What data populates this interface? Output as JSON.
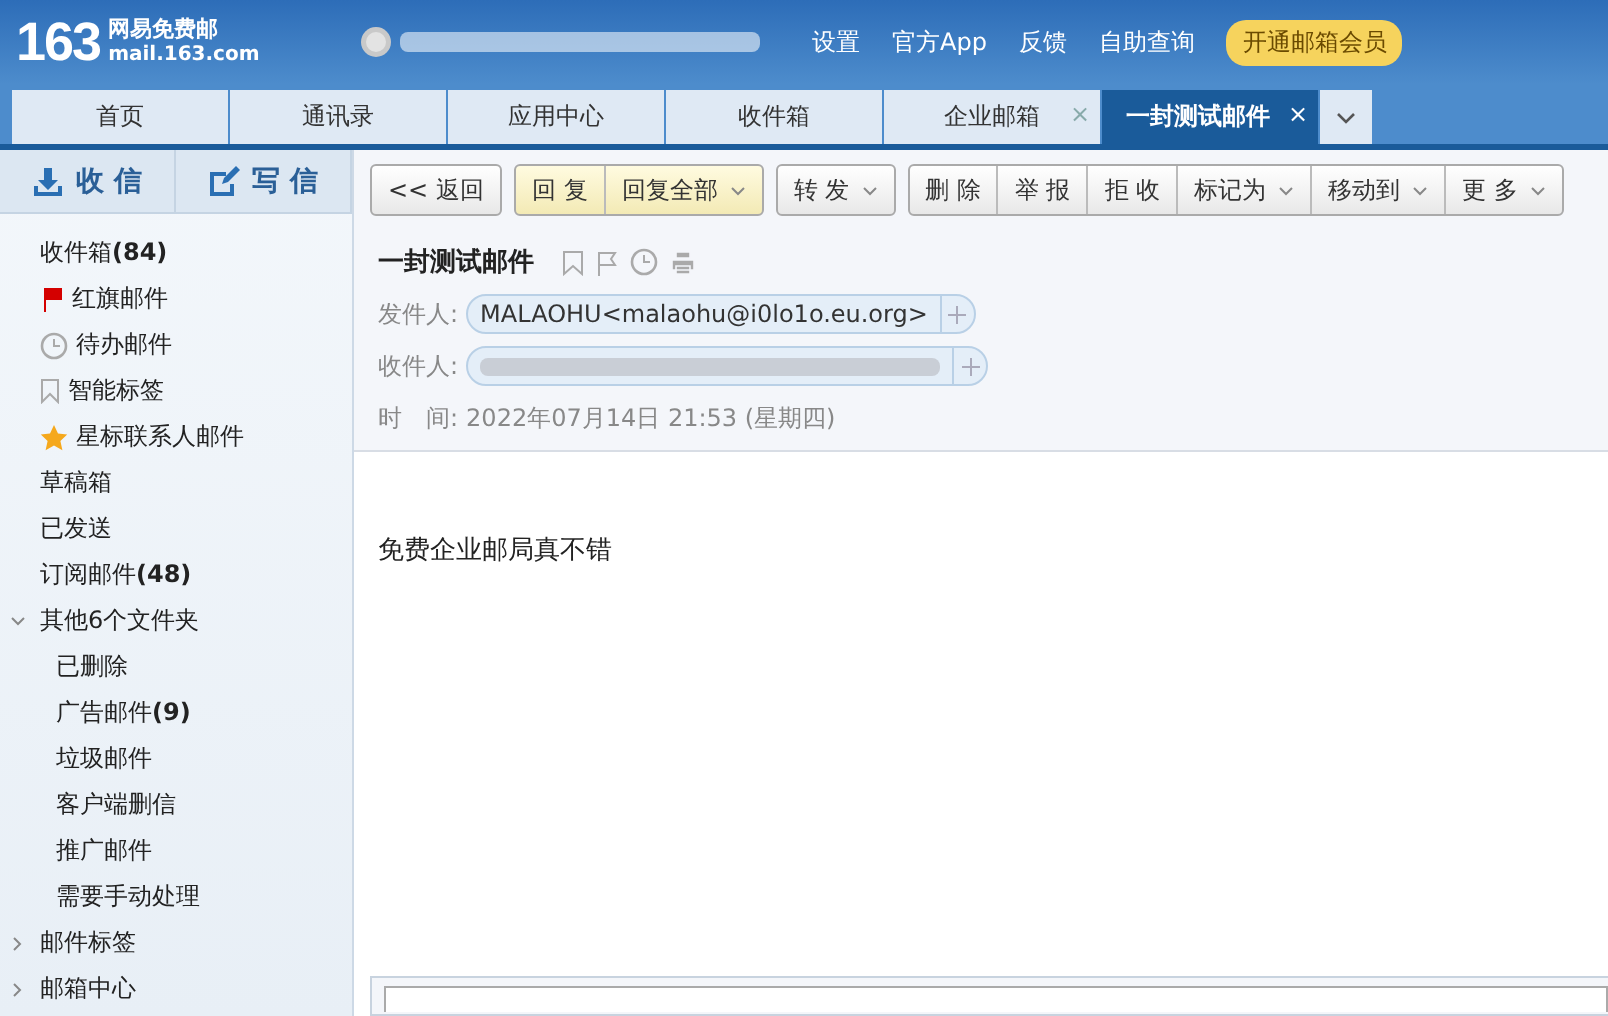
{
  "header": {
    "logo_number": "163",
    "logo_name": "网易免费邮",
    "logo_domain": "mail.163.com",
    "links": [
      "设置",
      "官方App",
      "反馈",
      "自助查询"
    ],
    "vip_button": "开通邮箱会员"
  },
  "tabs": [
    {
      "label": "首页",
      "selected": false,
      "closable": false
    },
    {
      "label": "通讯录",
      "selected": false,
      "closable": false
    },
    {
      "label": "应用中心",
      "selected": false,
      "closable": false
    },
    {
      "label": "收件箱",
      "selected": false,
      "closable": false
    },
    {
      "label": "企业邮箱",
      "selected": false,
      "closable": true
    },
    {
      "label": "一封测试邮件",
      "selected": true,
      "closable": true
    }
  ],
  "tab_close": "×",
  "sidebar": {
    "receive_button": "收 信",
    "compose_button": "写 信",
    "items": [
      {
        "label": "收件箱",
        "count": "(84)",
        "kind": "plain"
      },
      {
        "label": "红旗邮件",
        "kind": "flag"
      },
      {
        "label": "待办邮件",
        "kind": "clock"
      },
      {
        "label": "智能标签",
        "kind": "bookmark"
      },
      {
        "label": "星标联系人邮件",
        "kind": "star"
      },
      {
        "label": "草稿箱",
        "kind": "plain"
      },
      {
        "label": "已发送",
        "kind": "plain"
      },
      {
        "label": "订阅邮件",
        "count": "(48)",
        "kind": "plain"
      },
      {
        "label": "其他6个文件夹",
        "kind": "plain",
        "expanded": true,
        "children": [
          {
            "label": "已删除"
          },
          {
            "label": "广告邮件",
            "count": "(9)"
          },
          {
            "label": "垃圾邮件"
          },
          {
            "label": "客户端删信"
          },
          {
            "label": "推广邮件"
          },
          {
            "label": "需要手动处理"
          }
        ]
      },
      {
        "label": "邮件标签",
        "kind": "plain",
        "expanded": false
      },
      {
        "label": "邮箱中心",
        "kind": "plain",
        "expanded": false
      }
    ]
  },
  "toolbar": [
    {
      "kind": "plain",
      "buttons": [
        {
          "label": "<< 返回",
          "dropdown": false
        }
      ]
    },
    {
      "kind": "highlight",
      "buttons": [
        {
          "label": "回 复",
          "dropdown": false
        },
        {
          "label": "回复全部",
          "dropdown": true
        }
      ]
    },
    {
      "kind": "plain",
      "buttons": [
        {
          "label": "转 发",
          "dropdown": true
        }
      ]
    },
    {
      "kind": "plain",
      "buttons": [
        {
          "label": "删 除",
          "dropdown": false
        },
        {
          "label": "举 报",
          "dropdown": false
        },
        {
          "label": "拒 收",
          "dropdown": false
        },
        {
          "label": "标记为",
          "dropdown": true
        },
        {
          "label": "移动到",
          "dropdown": true
        },
        {
          "label": "更 多",
          "dropdown": true
        }
      ]
    }
  ],
  "mail": {
    "subject": "一封测试邮件",
    "sender_label": "发件人:",
    "sender": "MALAOHU<malaohu@i0lo1o.eu.org>",
    "recipient_label": "收件人:",
    "time_label": "时　间:",
    "time": "2022年07月14日 21:53 (星期四)",
    "body": "免费企业邮局真不错"
  }
}
